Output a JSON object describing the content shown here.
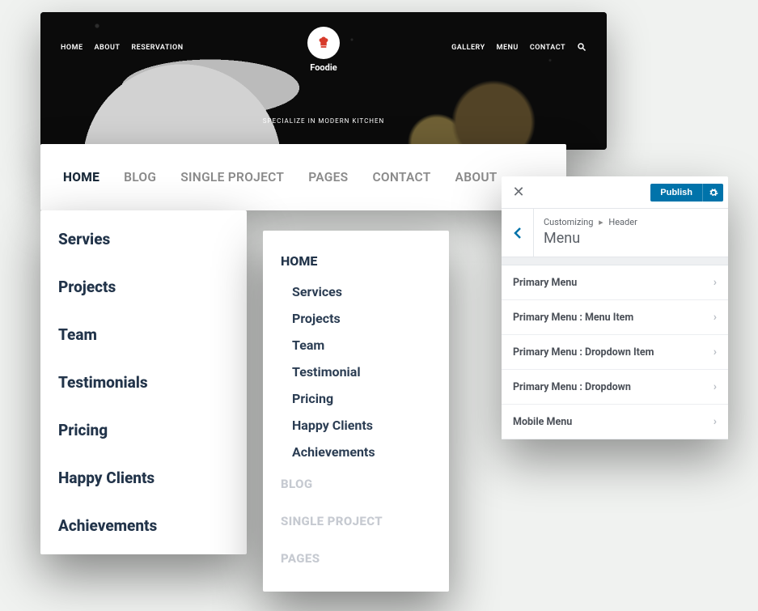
{
  "hero": {
    "brand": "Foodie",
    "tagline": "SPECIALIZE IN MODERN KITCHEN",
    "nav_left": [
      "HOME",
      "ABOUT",
      "RESERVATION"
    ],
    "nav_right": [
      "GALLERY",
      "MENU",
      "CONTACT"
    ]
  },
  "navbar": {
    "items": [
      "HOME",
      "BLOG",
      "SINGLE PROJECT",
      "PAGES",
      "CONTACT",
      "ABOUT"
    ]
  },
  "dropdown1": {
    "items": [
      "Servies",
      "Projects",
      "Team",
      "Testimonials",
      "Pricing",
      "Happy Clients",
      "Achievements"
    ]
  },
  "dropdown2": {
    "heading": "HOME",
    "sub_items": [
      "Services",
      "Projects",
      "Team",
      "Testimonial",
      "Pricing",
      "Happy Clients",
      "Achievements"
    ],
    "faded_items": [
      "BLOG",
      "SINGLE PROJECT",
      "PAGES"
    ]
  },
  "customizer": {
    "publish_label": "Publish",
    "breadcrumb": {
      "root": "Customizing",
      "section": "Header"
    },
    "title": "Menu",
    "items": [
      "Primary Menu",
      "Primary Menu : Menu Item",
      "Primary Menu : Dropdown Item",
      "Primary Menu : Dropdown",
      "Mobile Menu"
    ]
  }
}
